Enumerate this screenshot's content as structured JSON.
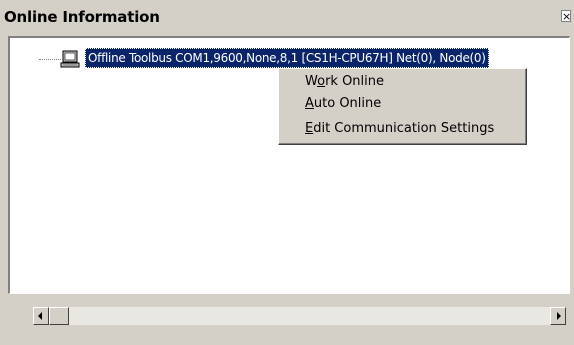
{
  "window": {
    "title": "Online Information",
    "close_glyph": "×"
  },
  "tree": {
    "node": {
      "icon": "computer-icon",
      "label": "Offline Toolbus COM1,9600,None,8,1 [CS1H-CPU67H] Net(0), Node(0)",
      "selected": true
    }
  },
  "context_menu": {
    "items": [
      {
        "pre": "W",
        "accel": "o",
        "post": "rk Online"
      },
      {
        "pre": "",
        "accel": "A",
        "post": "uto Online"
      },
      {
        "pre": "",
        "accel": "E",
        "post": "dit Communication Settings"
      }
    ]
  },
  "colors": {
    "window_bg": "#d4d0c8",
    "selection_bg": "#0a246a",
    "selection_text": "#ffffff"
  }
}
